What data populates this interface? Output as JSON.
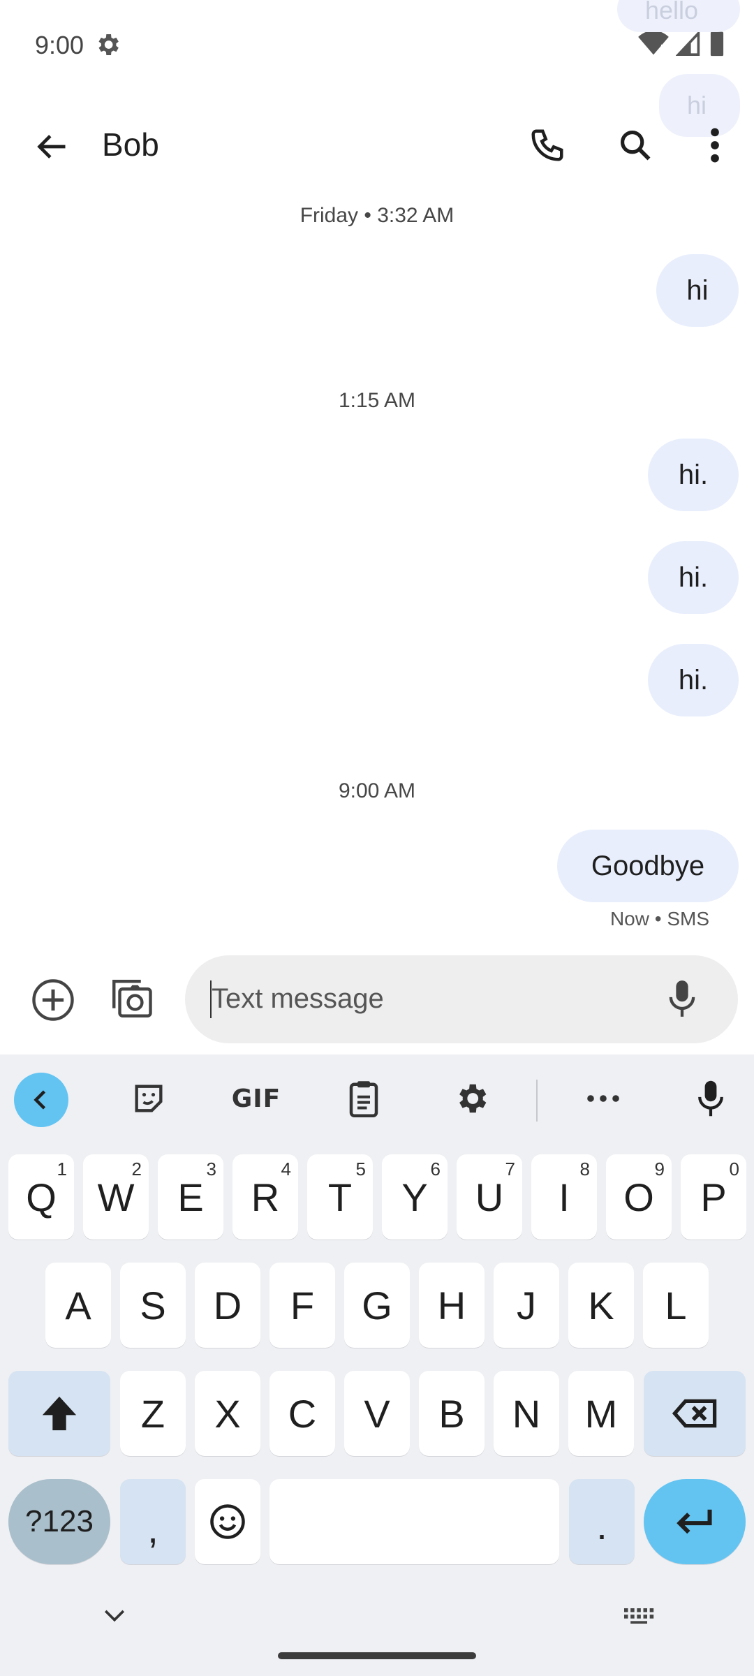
{
  "status_bar": {
    "time": "9:00"
  },
  "ghost_bubbles": [
    "hello",
    "hi"
  ],
  "app_bar": {
    "contact_name": "Bob"
  },
  "messages": {
    "groups": [
      {
        "timestamp": "Friday • 3:32 AM",
        "bubbles": [
          "hi"
        ]
      },
      {
        "timestamp": "1:15 AM",
        "bubbles": [
          "hi.",
          "hi.",
          "hi."
        ]
      },
      {
        "timestamp": "9:00 AM",
        "bubbles": [
          "Goodbye"
        ]
      }
    ],
    "last_meta": "Now • SMS"
  },
  "compose": {
    "placeholder": "Text message"
  },
  "keyboard": {
    "toolbar": {
      "gif_label": "GIF"
    },
    "row1": [
      {
        "l": "Q",
        "h": "1"
      },
      {
        "l": "W",
        "h": "2"
      },
      {
        "l": "E",
        "h": "3"
      },
      {
        "l": "R",
        "h": "4"
      },
      {
        "l": "T",
        "h": "5"
      },
      {
        "l": "Y",
        "h": "6"
      },
      {
        "l": "U",
        "h": "7"
      },
      {
        "l": "I",
        "h": "8"
      },
      {
        "l": "O",
        "h": "9"
      },
      {
        "l": "P",
        "h": "0"
      }
    ],
    "row2": [
      "A",
      "S",
      "D",
      "F",
      "G",
      "H",
      "J",
      "K",
      "L"
    ],
    "row3": [
      "Z",
      "X",
      "C",
      "V",
      "B",
      "N",
      "M"
    ],
    "symbols_label": "?123",
    "comma_label": ",",
    "period_label": "."
  },
  "colors": {
    "accent": "#63c4f2",
    "bubble": "#e8eefc",
    "keyboard_bg": "#eff0f4"
  }
}
